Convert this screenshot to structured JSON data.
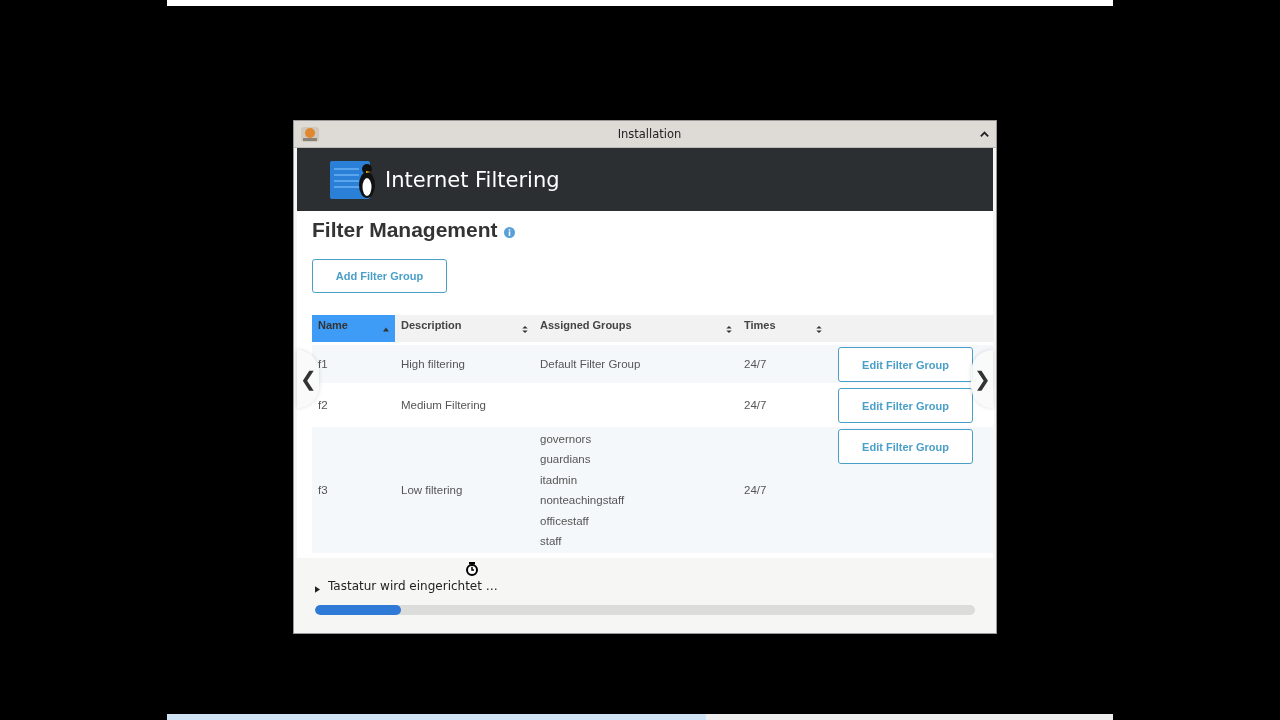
{
  "window": {
    "title": "Installation"
  },
  "banner": {
    "title": "Internet Filtering"
  },
  "page": {
    "heading": "Filter Management",
    "add_button": "Add Filter Group"
  },
  "table": {
    "columns": [
      {
        "label": "Name",
        "sorted": true
      },
      {
        "label": "Description",
        "sorted": false
      },
      {
        "label": "Assigned Groups",
        "sorted": false
      },
      {
        "label": "Times",
        "sorted": false
      }
    ],
    "rows": [
      {
        "name": "f1",
        "description": "High filtering",
        "groups": [
          "Default Filter Group"
        ],
        "times": "24/7",
        "action": "Edit Filter Group"
      },
      {
        "name": "f2",
        "description": "Medium Filtering",
        "groups": [],
        "times": "24/7",
        "action": "Edit Filter Group"
      },
      {
        "name": "f3",
        "description": "Low filtering",
        "groups": [
          "governors",
          "guardians",
          "itadmin",
          "nonteachingstaff",
          "officestaff",
          "staff"
        ],
        "times": "24/7",
        "action": "Edit Filter Group"
      }
    ]
  },
  "carousel": {
    "prev": "❮",
    "next": "❯"
  },
  "status": {
    "text": "Tastatur wird eingerichtet …",
    "level": 0.13
  }
}
